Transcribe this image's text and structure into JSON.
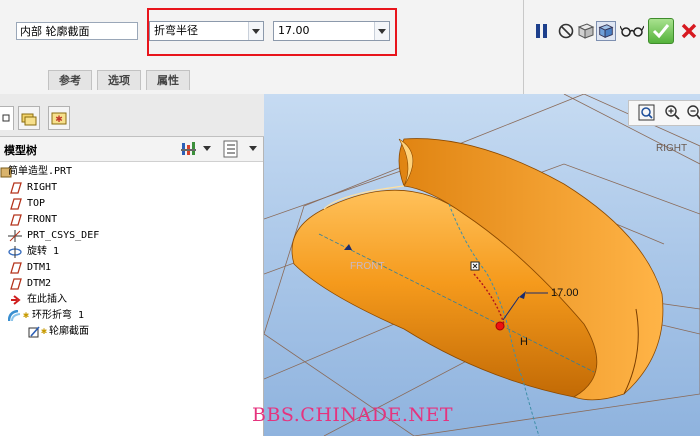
{
  "dashboard": {
    "reference_field": "内部 轮廓截面",
    "bend_option": {
      "selected": "折弯半径"
    },
    "radius_value": "17.00",
    "tabs": [
      {
        "label": "参考"
      },
      {
        "label": "选项"
      },
      {
        "label": "属性"
      }
    ]
  },
  "model_tree": {
    "title": "模型树",
    "items": [
      {
        "label": "简单造型.PRT",
        "icon": "part-icon"
      },
      {
        "label": "RIGHT",
        "icon": "datum-plane-icon"
      },
      {
        "label": "TOP",
        "icon": "datum-plane-icon"
      },
      {
        "label": "FRONT",
        "icon": "datum-plane-icon"
      },
      {
        "label": "PRT_CSYS_DEF",
        "icon": "csys-icon"
      },
      {
        "label": "旋转 1",
        "icon": "revolve-icon"
      },
      {
        "label": "DTM1",
        "icon": "datum-plane-icon"
      },
      {
        "label": "DTM2",
        "icon": "datum-plane-icon"
      },
      {
        "label": "在此插入",
        "icon": "insert-arrow-icon"
      },
      {
        "label": "环形折弯 1",
        "icon": "toroidal-bend-icon"
      },
      {
        "label": "轮廓截面",
        "icon": "sketch-icon"
      }
    ]
  },
  "viewport": {
    "labels": {
      "right": "RIGHT",
      "front": "FRONT",
      "dimension": "17.00",
      "h_marker": "H"
    },
    "watermark": "BBS.CHINADE.NET"
  },
  "colors": {
    "accent_red": "#e8141b",
    "model_orange": "#f59a1c",
    "watermark": "#e5337e",
    "confirm_green": "#54b23b"
  }
}
